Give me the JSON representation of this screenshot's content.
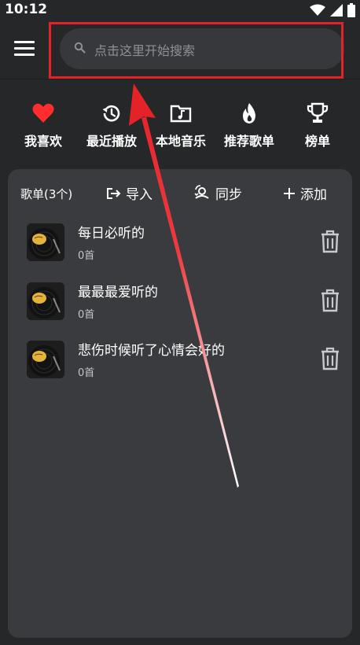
{
  "status_bar": {
    "time": "10:12"
  },
  "search": {
    "placeholder": "点击这里开始搜索"
  },
  "quick_nav": [
    {
      "label": "我喜欢",
      "icon": "heart-icon"
    },
    {
      "label": "最近播放",
      "icon": "history-icon"
    },
    {
      "label": "本地音乐",
      "icon": "music-folder-icon"
    },
    {
      "label": "推荐歌单",
      "icon": "flame-icon"
    },
    {
      "label": "榜单",
      "icon": "trophy-icon"
    }
  ],
  "playlists_panel": {
    "count_label": "歌单(3个)",
    "import_label": "导入",
    "sync_label": "同步",
    "add_label": "添加",
    "items": [
      {
        "title": "每日必听的",
        "subtitle": "0首"
      },
      {
        "title": "最最最爱听的",
        "subtitle": "0首"
      },
      {
        "title": "悲伤时候听了心情会好的",
        "subtitle": "0首"
      }
    ]
  },
  "colors": {
    "background": "#262729",
    "search_box": "#36383c",
    "panel": "#3a3b3e",
    "accent_red": "#e52228",
    "heart": "#ff2d2d"
  }
}
